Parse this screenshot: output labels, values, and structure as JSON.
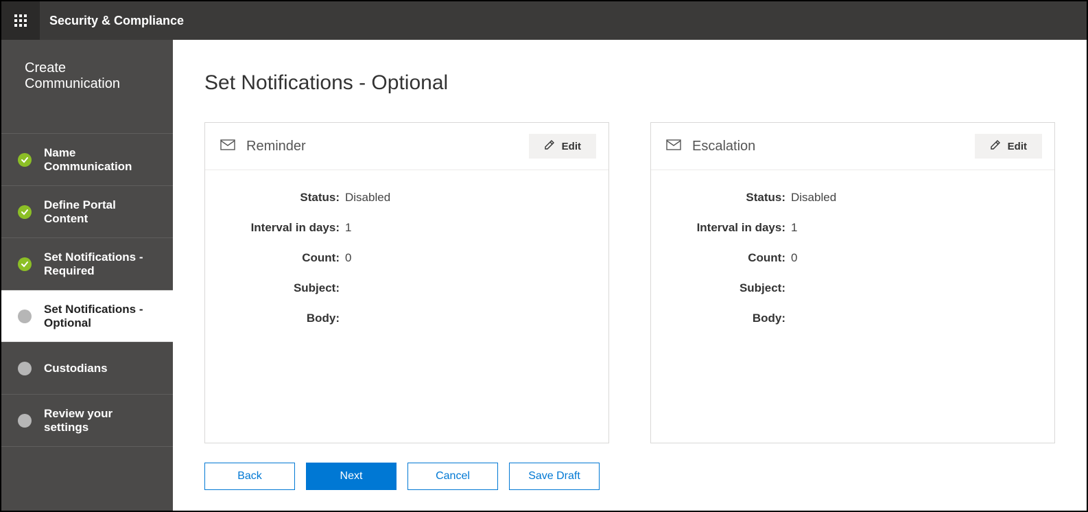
{
  "header": {
    "app_title": "Security & Compliance"
  },
  "sidebar": {
    "title": "Create Communication",
    "steps": [
      {
        "label": "Name Communication",
        "state": "done"
      },
      {
        "label": "Define Portal Content",
        "state": "done"
      },
      {
        "label": "Set Notifications - Required",
        "state": "done"
      },
      {
        "label": "Set Notifications - Optional",
        "state": "active"
      },
      {
        "label": "Custodians",
        "state": "pending"
      },
      {
        "label": "Review your settings",
        "state": "pending"
      }
    ]
  },
  "main": {
    "page_title": "Set Notifications - Optional",
    "cards": [
      {
        "title": "Reminder",
        "edit_label": "Edit",
        "fields": {
          "status_label": "Status:",
          "status_value": "Disabled",
          "interval_label": "Interval in days:",
          "interval_value": "1",
          "count_label": "Count:",
          "count_value": "0",
          "subject_label": "Subject:",
          "subject_value": "",
          "body_label": "Body:",
          "body_value": ""
        }
      },
      {
        "title": "Escalation",
        "edit_label": "Edit",
        "fields": {
          "status_label": "Status:",
          "status_value": "Disabled",
          "interval_label": "Interval in days:",
          "interval_value": "1",
          "count_label": "Count:",
          "count_value": "0",
          "subject_label": "Subject:",
          "subject_value": "",
          "body_label": "Body:",
          "body_value": ""
        }
      }
    ],
    "buttons": {
      "back": "Back",
      "next": "Next",
      "cancel": "Cancel",
      "save_draft": "Save Draft"
    }
  }
}
